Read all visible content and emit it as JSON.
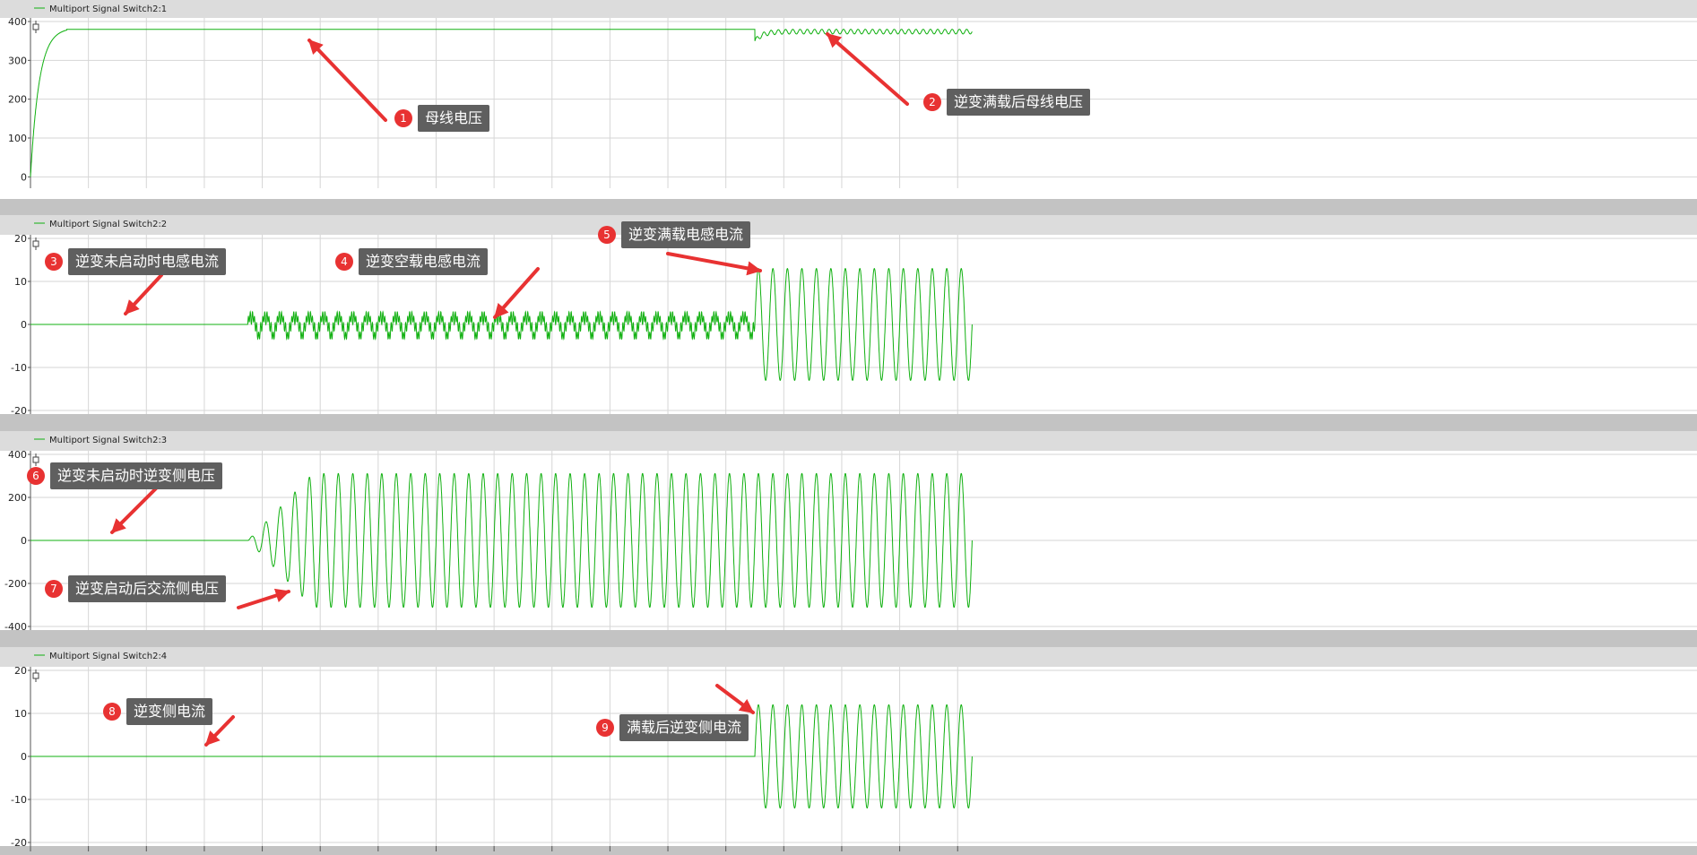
{
  "colors": {
    "trace": "#10b010",
    "grid": "#d6d6d6",
    "legend_bg": "#dcdcdc",
    "separator": "#c3c3c3",
    "arrow": "#e83232",
    "badge": "#e83232",
    "callout_bg": "#5f5f5f"
  },
  "icons": {
    "panel_marker": "cursor-marker-icon"
  },
  "chart_data": [
    {
      "type": "line",
      "legend": "Multiport Signal Switch2:1",
      "ylim": [
        -20,
        400
      ],
      "yticks": [
        "400",
        "300",
        "200",
        "100",
        "0"
      ],
      "series": [
        {
          "kind": "dc_bus",
          "steady": 380,
          "ripple_after": 12,
          "event_times": [
            0,
            1.0
          ]
        }
      ]
    },
    {
      "type": "line",
      "legend": "Multiport Signal Switch2:2",
      "ylim": [
        -20,
        20
      ],
      "yticks": [
        "20",
        "10",
        "0",
        "-10",
        "-20"
      ],
      "series": [
        {
          "kind": "inductor_current",
          "amplitude_noload": 3,
          "amplitude_fullload": 13,
          "event_times": [
            0.3,
            1.0
          ]
        }
      ]
    },
    {
      "type": "line",
      "legend": "Multiport Signal Switch2:3",
      "ylim": [
        -400,
        400
      ],
      "yticks": [
        "400",
        "200",
        "0",
        "-200",
        "-400"
      ],
      "series": [
        {
          "kind": "inverter_voltage",
          "amplitude": 311,
          "event_times": [
            0.3
          ]
        }
      ]
    },
    {
      "type": "line",
      "legend": "Multiport Signal Switch2:4",
      "ylim": [
        -20,
        20
      ],
      "yticks": [
        "20",
        "10",
        "0",
        "-10",
        "-20"
      ],
      "series": [
        {
          "kind": "inverter_current",
          "amplitude": 12,
          "event_times": [
            1.0
          ]
        }
      ]
    }
  ],
  "x_axis": {
    "xlim": [
      0,
      1.3
    ],
    "frequency_hz": 50
  },
  "annotations": [
    {
      "num": "1",
      "text": "母线电压"
    },
    {
      "num": "2",
      "text": "逆变满载后母线电压"
    },
    {
      "num": "3",
      "text": "逆变未启动时电感电流"
    },
    {
      "num": "4",
      "text": "逆变空载电感电流"
    },
    {
      "num": "5",
      "text": "逆变满载电感电流"
    },
    {
      "num": "6",
      "text": "逆变未启动时逆变侧电压"
    },
    {
      "num": "7",
      "text": "逆变启动后交流侧电压"
    },
    {
      "num": "8",
      "text": "逆变侧电流"
    },
    {
      "num": "9",
      "text": "满载后逆变侧电流"
    }
  ]
}
